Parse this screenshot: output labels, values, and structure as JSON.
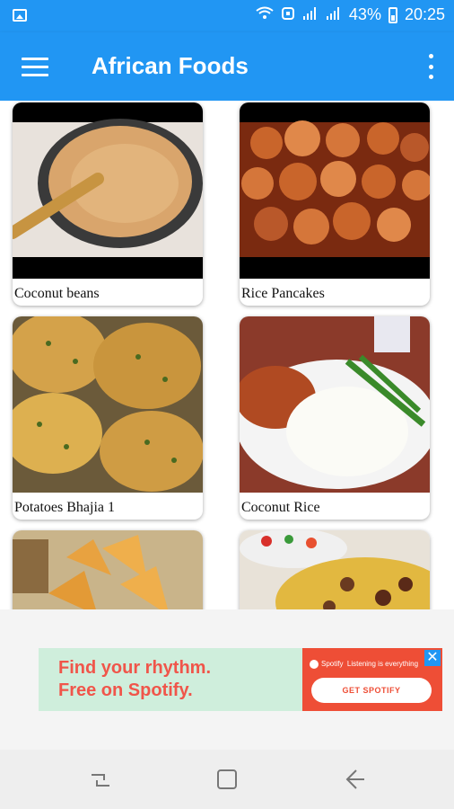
{
  "status_bar": {
    "battery": "43%",
    "time": "20:25",
    "icons": [
      "gallery-icon",
      "wifi-icon",
      "hotspot-icon",
      "signal-icon",
      "signal-icon",
      "battery-icon"
    ]
  },
  "app_bar": {
    "title": "African Foods",
    "menu_icon": "hamburger-menu-icon",
    "overflow_icon": "more-vert-icon"
  },
  "recipes": [
    {
      "label": "Coconut beans"
    },
    {
      "label": "Rice Pancakes"
    },
    {
      "label": "Potatoes Bhajia 1"
    },
    {
      "label": "Coconut Rice"
    },
    {
      "label": ""
    },
    {
      "label": ""
    }
  ],
  "ad": {
    "headline_line1": "Find your rhythm.",
    "headline_line2": "Free on Spotify.",
    "brand": "Spotify",
    "tagline": "Listening is everything",
    "cta": "GET SPOTIFY",
    "close_icon": "close-icon",
    "colors": {
      "background": "#cfeedc",
      "text": "#f0554a",
      "panel": "#ee4e36"
    }
  },
  "nav_bar": {
    "icons": [
      "recent-apps-icon",
      "home-icon",
      "back-icon"
    ]
  },
  "colors": {
    "primary": "#2196f3"
  }
}
